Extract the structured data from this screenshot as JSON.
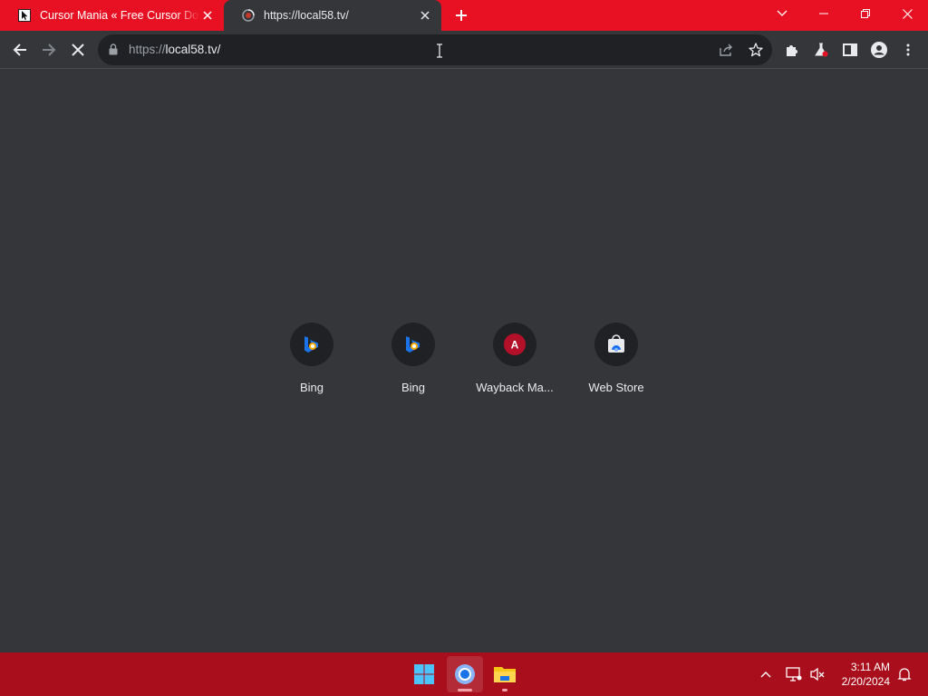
{
  "window": {
    "tabs": [
      {
        "title": "Cursor Mania « Free Cursor Downloads",
        "favicon": "cursor-arrow-icon",
        "active": false
      },
      {
        "title": "https://local58.tv/",
        "favicon": "loading-globe-icon",
        "active": true
      }
    ],
    "controls": [
      "tab-search-icon",
      "minimize-icon",
      "restore-icon",
      "close-icon"
    ]
  },
  "toolbar": {
    "url_scheme": "https://",
    "url_host": "local58.tv/",
    "loading": true
  },
  "shortcuts": [
    {
      "label": "Bing",
      "icon": "bing-icon"
    },
    {
      "label": "Bing",
      "icon": "bing-icon"
    },
    {
      "label": "Wayback Ma...",
      "icon": "wayback-machine-icon",
      "letter": "A"
    },
    {
      "label": "Web Store",
      "icon": "web-store-icon"
    }
  ],
  "taskbar": {
    "apps": [
      "windows-start-icon",
      "chrome-icon",
      "file-explorer-icon"
    ],
    "clock_time": "3:11 AM",
    "clock_date": "2/20/2024"
  },
  "colors": {
    "accent_red": "#e81123",
    "taskbar_red": "#a80e1b",
    "page_bg": "#35363a",
    "omnibox_bg": "#202124"
  }
}
